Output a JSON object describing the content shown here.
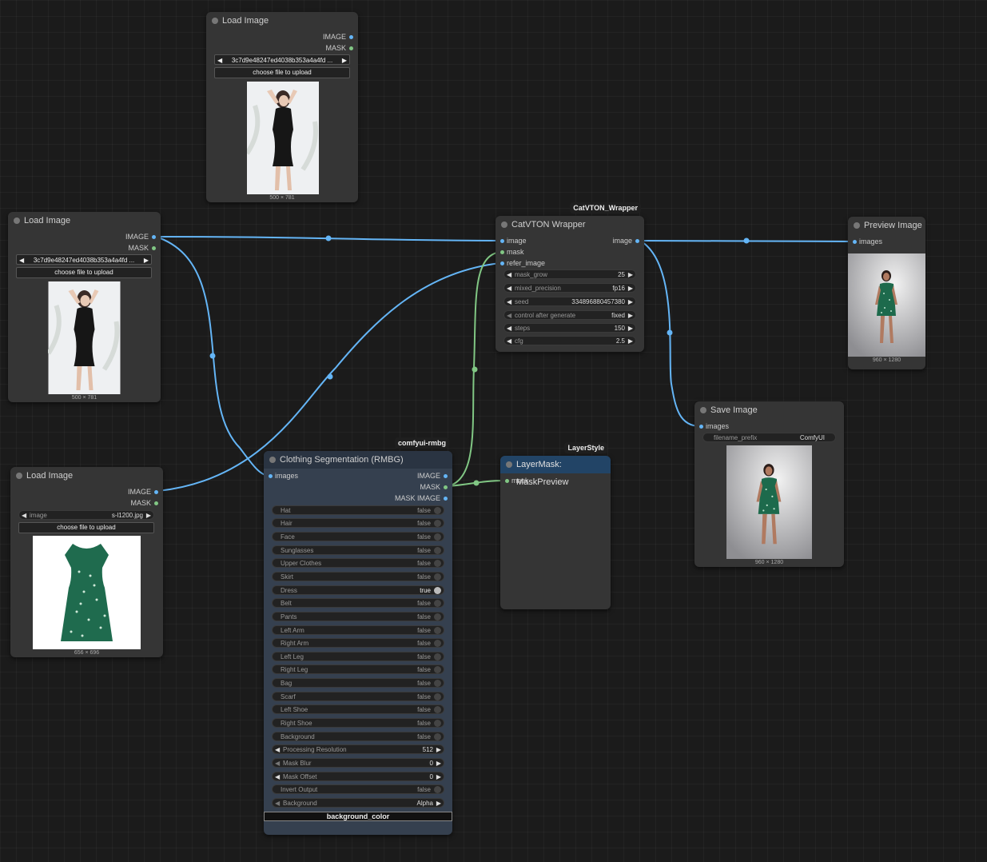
{
  "colors": {
    "image_port": "#64b5f6",
    "mask_port": "#81c784",
    "canvas": "#1b1b1b",
    "node": "#353535"
  },
  "load_image_top": {
    "title": "Load Image",
    "outputs": [
      "IMAGE",
      "MASK"
    ],
    "file": "3c7d9e48247ed4038b353a4a4fd ...",
    "upload_label": "choose file to upload",
    "dimensions": "500 × 781"
  },
  "load_image_mid": {
    "title": "Load Image",
    "outputs": [
      "IMAGE",
      "MASK"
    ],
    "file": "3c7d9e48247ed4038b353a4a4fd ...",
    "upload_label": "choose file to upload",
    "dimensions": "500 × 781"
  },
  "load_image_bottom": {
    "title": "Load Image",
    "outputs": [
      "IMAGE",
      "MASK"
    ],
    "file_label": "image",
    "file": "s-l1200.jpg",
    "upload_label": "choose file to upload",
    "dimensions": "656 × 696"
  },
  "catvton": {
    "badge": "CatVTON_Wrapper",
    "title": "CatVTON Wrapper",
    "inputs": [
      "image",
      "mask",
      "refer_image"
    ],
    "output": "image",
    "widgets": [
      {
        "label": "mask_grow",
        "value": "25"
      },
      {
        "label": "mixed_precision",
        "value": "fp16"
      },
      {
        "label": "seed",
        "value": "334896880457380"
      },
      {
        "label": "control after generate",
        "value": "fixed"
      },
      {
        "label": "steps",
        "value": "150"
      },
      {
        "label": "cfg",
        "value": "2.5"
      }
    ]
  },
  "preview": {
    "title": "Preview Image",
    "input": "images",
    "dimensions": "960 × 1280"
  },
  "save": {
    "title": "Save Image",
    "input": "images",
    "prefix_label": "filename_prefix",
    "prefix_value": "ComfyUI",
    "dimensions": "960 × 1280"
  },
  "rmbg": {
    "badge": "comfyui-rmbg",
    "title": "Clothing Segmentation (RMBG)",
    "input": "images",
    "outputs": [
      "IMAGE",
      "MASK",
      "MASK IMAGE"
    ],
    "toggles": [
      {
        "label": "Hat",
        "value": "false"
      },
      {
        "label": "Hair",
        "value": "false"
      },
      {
        "label": "Face",
        "value": "false"
      },
      {
        "label": "Sunglasses",
        "value": "false"
      },
      {
        "label": "Upper Clothes",
        "value": "false"
      },
      {
        "label": "Skirt",
        "value": "false"
      },
      {
        "label": "Dress",
        "value": "true"
      },
      {
        "label": "Belt",
        "value": "false"
      },
      {
        "label": "Pants",
        "value": "false"
      },
      {
        "label": "Left Arm",
        "value": "false"
      },
      {
        "label": "Right Arm",
        "value": "false"
      },
      {
        "label": "Left Leg",
        "value": "false"
      },
      {
        "label": "Right Leg",
        "value": "false"
      },
      {
        "label": "Bag",
        "value": "false"
      },
      {
        "label": "Scarf",
        "value": "false"
      },
      {
        "label": "Left Shoe",
        "value": "false"
      },
      {
        "label": "Right Shoe",
        "value": "false"
      },
      {
        "label": "Background",
        "value": "false"
      }
    ],
    "processing_resolution": {
      "label": "Processing Resolution",
      "value": "512"
    },
    "mask_blur": {
      "label": "Mask Blur",
      "value": "0"
    },
    "mask_offset": {
      "label": "Mask Offset",
      "value": "0"
    },
    "invert_output": {
      "label": "Invert Output",
      "value": "false"
    },
    "background": {
      "label": "Background",
      "value": "Alpha"
    },
    "background_color_button": "background_color"
  },
  "layermask": {
    "badge": "LayerStyle",
    "title": "LayerMask: MaskPreview",
    "input": "mask"
  }
}
